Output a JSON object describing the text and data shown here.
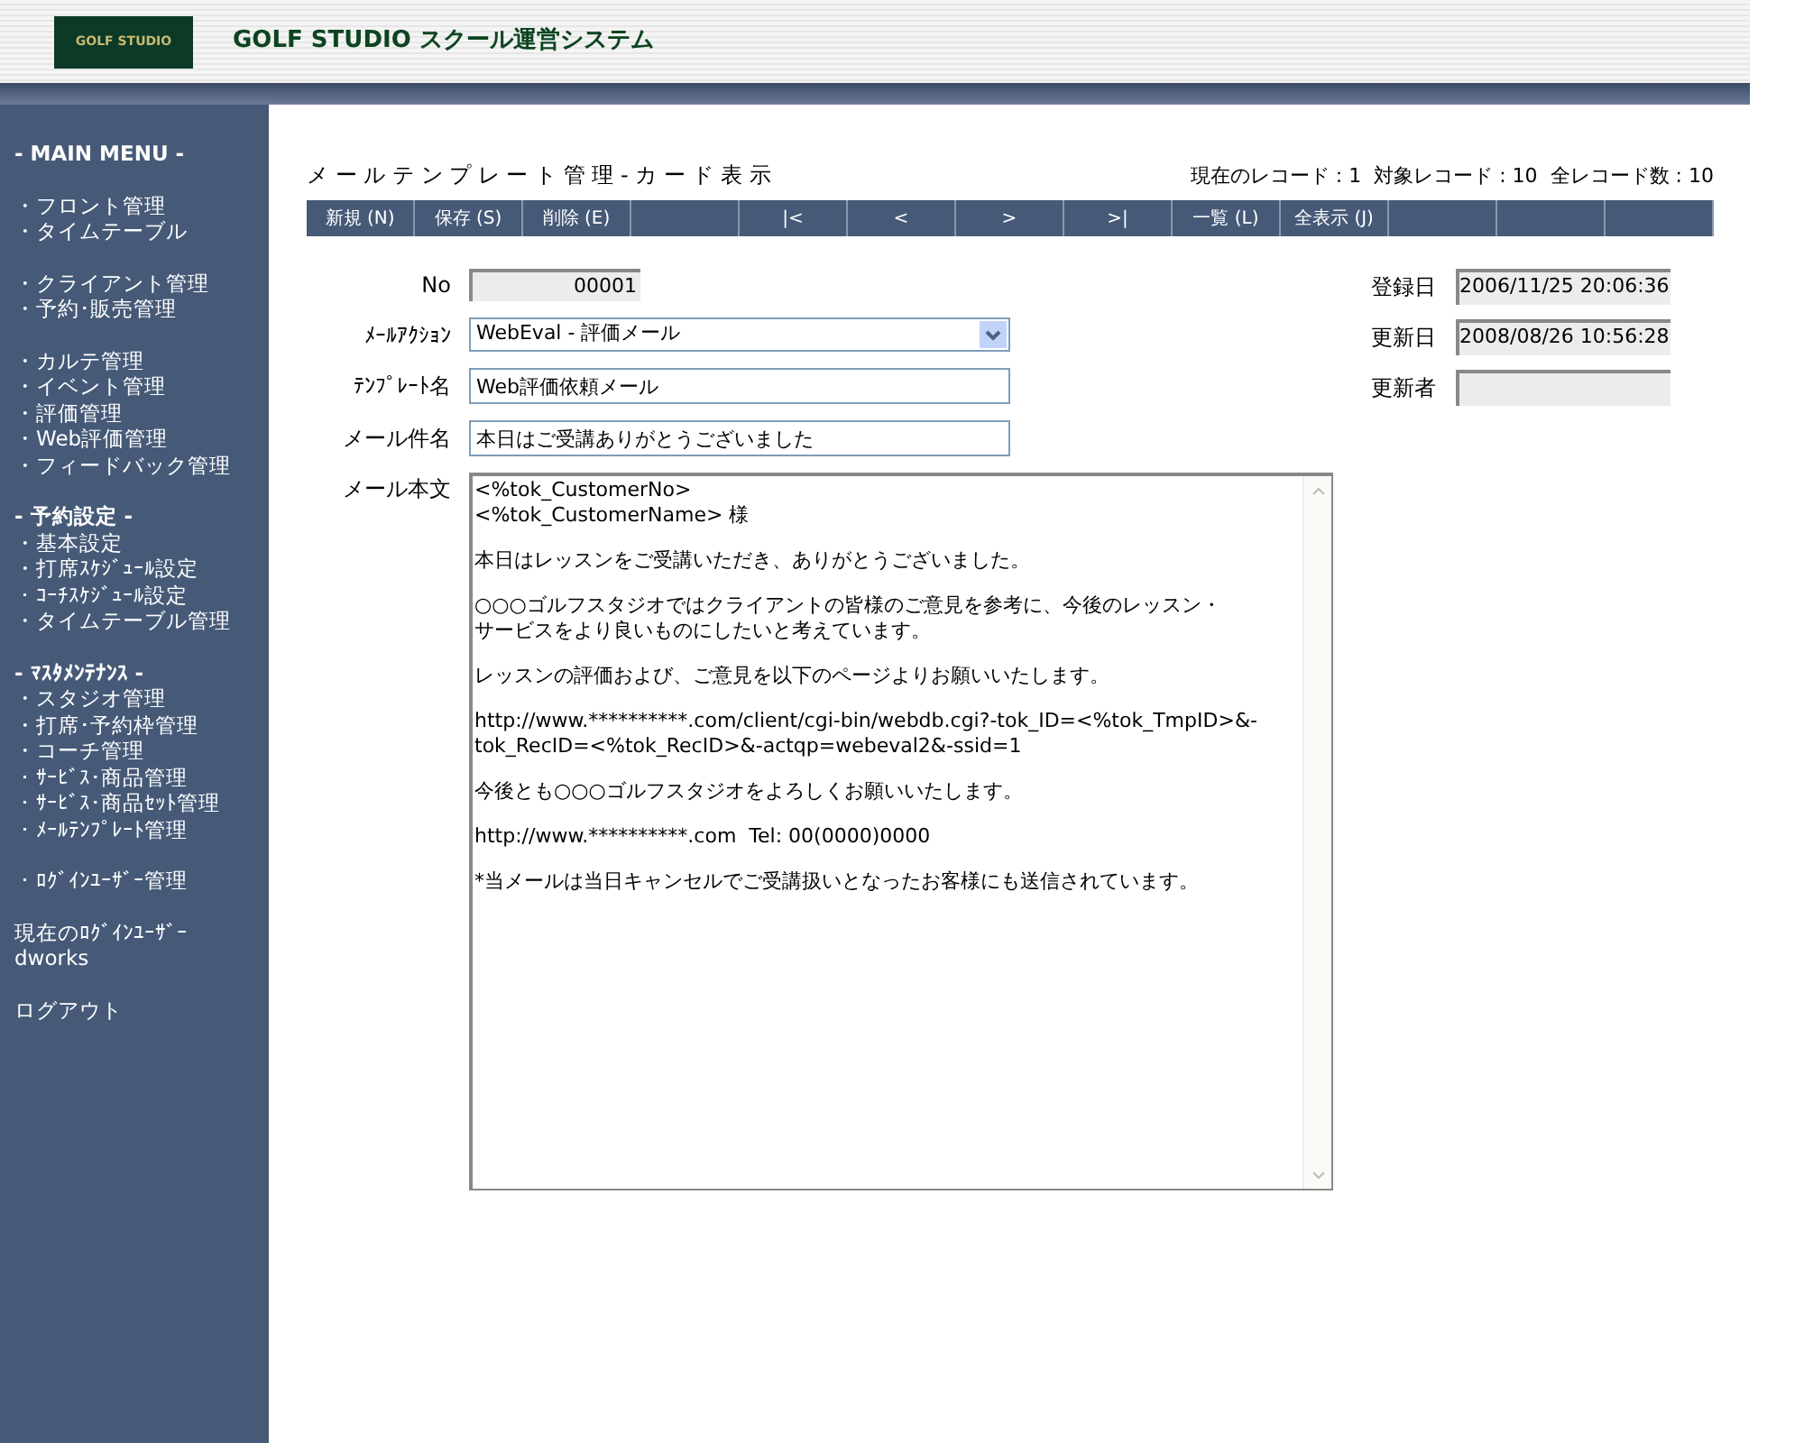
{
  "header": {
    "logo": "GOLF STUDIO",
    "title": "GOLF STUDIO スクール運営システム"
  },
  "sidebar": {
    "groups": [
      {
        "heading": "- MAIN MENU -"
      },
      {
        "items": [
          "・フロント管理",
          "・タイムテーブル"
        ]
      },
      {
        "items": [
          "・クライアント管理",
          "・予約･販売管理"
        ]
      },
      {
        "items": [
          "・カルテ管理",
          "・イベント管理",
          "・評価管理",
          "・Web評価管理",
          "・フィードバック管理"
        ]
      },
      {
        "heading": "- 予約設定 -",
        "items": [
          "・基本設定",
          "・打席ｽｹｼﾞｭｰﾙ設定",
          "・ｺｰﾁｽｹｼﾞｭｰﾙ設定",
          "・タイムテーブル管理"
        ]
      },
      {
        "heading": "- ﾏｽﾀﾒﾝﾃﾅﾝｽ -",
        "items": [
          "・スタジオ管理",
          "・打席･予約枠管理",
          "・コーチ管理",
          "・ｻｰﾋﾞｽ･商品管理",
          "・ｻｰﾋﾞｽ･商品ｾｯﾄ管理",
          "・ﾒｰﾙﾃﾝﾌﾟﾚｰﾄ管理"
        ]
      },
      {
        "items": [
          "・ﾛｸﾞｲﾝﾕｰｻﾞｰ管理"
        ]
      },
      {
        "items": [
          "現在のﾛｸﾞｲﾝﾕｰｻﾞｰ",
          "dworks"
        ]
      },
      {
        "items": [
          "ログアウト"
        ]
      }
    ]
  },
  "page_title": "メ ー ル テ ン プ レ ー ト 管 理 - カ ー ド 表 示",
  "record_info": "現在のレコード : 1  対象レコード : 10  全レコード数 : 10",
  "toolbar": [
    {
      "kind": "button",
      "label": "新規 (N)"
    },
    {
      "kind": "button",
      "label": "保存 (S)"
    },
    {
      "kind": "button",
      "label": "削除 (E)"
    },
    {
      "kind": "blank"
    },
    {
      "kind": "button",
      "label": "|<"
    },
    {
      "kind": "button",
      "label": "<"
    },
    {
      "kind": "button",
      "label": ">"
    },
    {
      "kind": "button",
      "label": ">|"
    },
    {
      "kind": "button",
      "label": "一覧 (L)"
    },
    {
      "kind": "button",
      "label": "全表示 (J)"
    },
    {
      "kind": "blank"
    },
    {
      "kind": "blank"
    },
    {
      "kind": "blank"
    }
  ],
  "form": {
    "no": {
      "label": "No",
      "value": "00001"
    },
    "action": {
      "label": "ﾒｰﾙｱｸｼｮﾝ",
      "value": "WebEval - 評価メール"
    },
    "template_name": {
      "label": "ﾃﾝﾌﾟﾚｰﾄ名",
      "value": "Web評価依頼メール"
    },
    "subject": {
      "label": "メール件名",
      "value": "本日はご受講ありがとうございました"
    },
    "body": {
      "label": "メール本文",
      "paragraphs": [
        [
          "<%tok_CustomerNo>",
          "<%tok_CustomerName> 様"
        ],
        [
          "本日はレッスンをご受講いただき、ありがとうございました。"
        ],
        [
          "○○○ゴルフスタジオではクライアントの皆様のご意見を参考に、今後のレッスン・",
          "サービスをより良いものにしたいと考えています。"
        ],
        [
          "レッスンの評価および、ご意見を以下のページよりお願いいたします。"
        ],
        [
          "http://www.**********.com/client/cgi-bin/webdb.cgi?-tok_ID=<%tok_TmpID>&-",
          "tok_RecID=<%tok_RecID>&-actqp=webeval2&-ssid=1"
        ],
        [
          "今後とも○○○ゴルフスタジオをよろしくお願いいたします。"
        ],
        [
          "http://www.**********.com  Tel: 00(0000)0000"
        ],
        [
          "*当メールは当日キャンセルでご受講扱いとなったお客様にも送信されています。"
        ]
      ]
    },
    "created": {
      "label": "登録日",
      "value": "2006/11/25 20:06:36"
    },
    "updated": {
      "label": "更新日",
      "value": "2008/08/26 10:56:28"
    },
    "updated_by": {
      "label": "更新者"
    }
  }
}
